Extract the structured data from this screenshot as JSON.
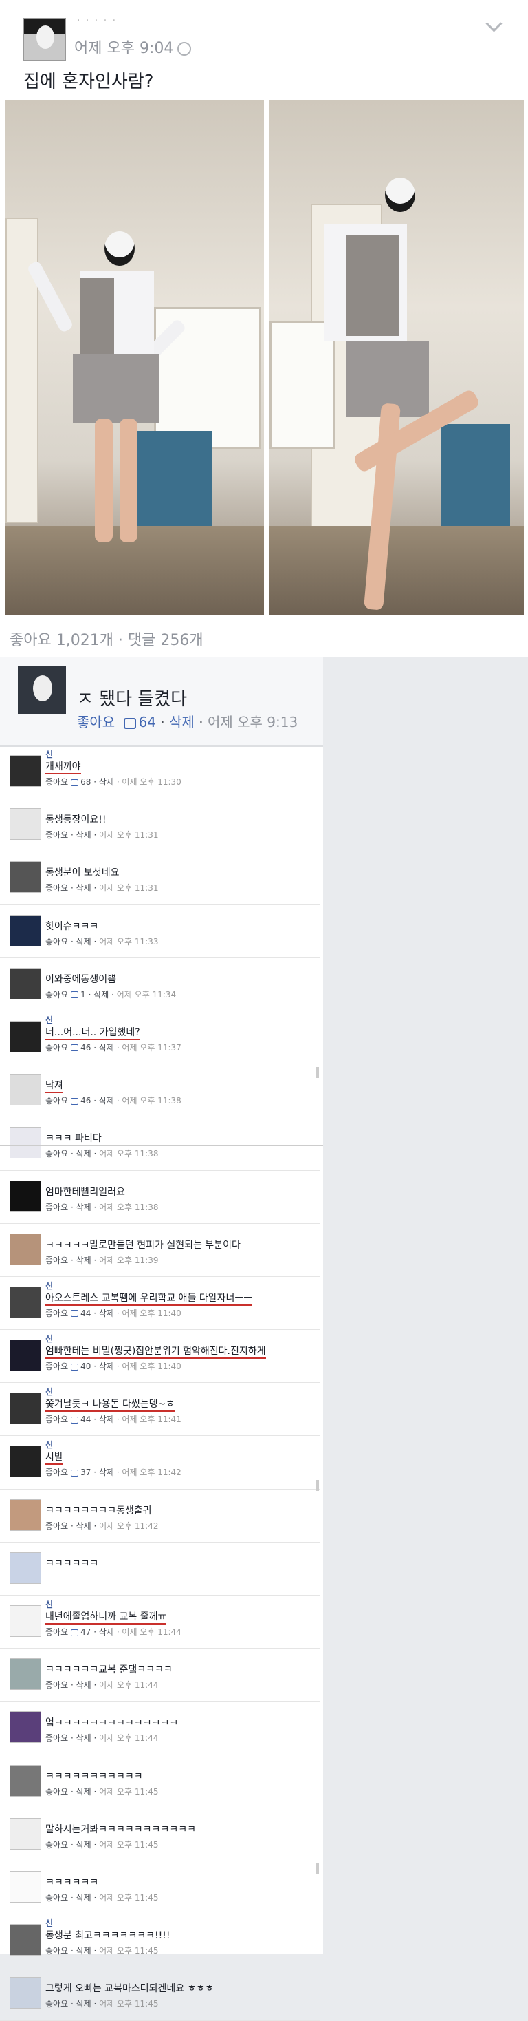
{
  "post": {
    "name": "· · · · ·",
    "time": "어제 오후 9:04",
    "text": "집에 혼자인사람?",
    "stats": "좋아요 1,021개 · 댓글 256개"
  },
  "top_comment": {
    "text": "ㅈ 됐다 들켰다",
    "like_label": "좋아요",
    "like_count": "64",
    "delete_label": "삭제",
    "time": "어제 오후 9:13"
  },
  "comments": [
    {
      "name": "신",
      "text": "개새끼야",
      "like": "좋아요",
      "count": "68",
      "del": "삭제",
      "time": "어제 오후 11:30",
      "red": true
    },
    {
      "name": "",
      "text": "동생등장이요!!",
      "like": "좋아요",
      "count": "",
      "del": "삭제",
      "time": "어제 오후 11:31",
      "red": false
    },
    {
      "name": "",
      "text": "동생분이 보셧네요",
      "like": "좋아요",
      "count": "",
      "del": "삭제",
      "time": "어제 오후 11:31",
      "red": false
    },
    {
      "name": "",
      "text": "핫이슈ㅋㅋㅋ",
      "like": "좋아요",
      "count": "",
      "del": "삭제",
      "time": "어제 오후 11:33",
      "red": false
    },
    {
      "name": "",
      "text": "이와중에동생이쁨",
      "like": "좋아요",
      "count": "1",
      "del": "삭제",
      "time": "어제 오후 11:34",
      "red": false
    },
    {
      "name": "신",
      "text": "너...어...너.. 가입했네?",
      "like": "좋아요",
      "count": "46",
      "del": "삭제",
      "time": "어제 오후 11:37",
      "red": true
    },
    {
      "name": "",
      "text": "닥져",
      "like": "좋아요",
      "count": "46",
      "del": "삭제",
      "time": "어제 오후 11:38",
      "red": true
    },
    {
      "name": "",
      "text": "ㅋㅋㅋ 파티다",
      "like": "좋아요",
      "count": "",
      "del": "삭제",
      "time": "어제 오후 11:38",
      "red": false
    },
    {
      "name": "",
      "text": "엄마한테빨리일러요",
      "like": "좋아요",
      "count": "",
      "del": "삭제",
      "time": "어제 오후 11:38",
      "red": false
    },
    {
      "name": "",
      "text": "ㅋㅋㅋㅋㅋ말로만듣던 현피가 실현되는 부분이다",
      "like": "좋아요",
      "count": "",
      "del": "삭제",
      "time": "어제 오후 11:39",
      "red": false
    },
    {
      "name": "신",
      "text": "아오스트레스 교복뗌에 우리학교 애들 다알자너ㅡㅡ",
      "like": "좋아요",
      "count": "44",
      "del": "삭제",
      "time": "어제 오후 11:40",
      "red": true
    },
    {
      "name": "신",
      "text": "엄빠한테는 비밀(찡긋)집안분위기 험악해진다.진지하게",
      "like": "좋아요",
      "count": "40",
      "del": "삭제",
      "time": "어제 오후 11:40",
      "red": true
    },
    {
      "name": "신",
      "text": "쫓겨날듯ㅋ 나용돈 다썼는뎅~ㅎ",
      "like": "좋아요",
      "count": "44",
      "del": "삭제",
      "time": "어제 오후 11:41",
      "red": true
    },
    {
      "name": "신",
      "text": "시발",
      "like": "좋아요",
      "count": "37",
      "del": "삭제",
      "time": "어제 오후 11:42",
      "red": true
    },
    {
      "name": "",
      "text": "ㅋㅋㅋㅋㅋㅋㅋㅋ동생출귀",
      "like": "좋아요",
      "count": "",
      "del": "삭제",
      "time": "어제 오후 11:42",
      "red": false
    },
    {
      "name": "",
      "text": "ㅋㅋㅋㅋㅋㅋ",
      "like": "",
      "count": "",
      "del": "",
      "time": "",
      "red": false
    },
    {
      "name": "신",
      "text": "내년에졸업하니까 교복 줄께ㅠ",
      "like": "좋아요",
      "count": "47",
      "del": "삭제",
      "time": "어제 오후 11:44",
      "red": true
    },
    {
      "name": "",
      "text": "ㅋㅋㅋㅋㅋㅋ교복 준댘ㅋㅋㅋㅋ",
      "like": "좋아요",
      "count": "",
      "del": "삭제",
      "time": "어제 오후 11:44",
      "red": false
    },
    {
      "name": "",
      "text": "엌ㅋㅋㅋㅋㅋㅋㅋㅋㅋㅋㅋㅋㅋㅋ",
      "like": "좋아요",
      "count": "",
      "del": "삭제",
      "time": "어제 오후 11:44",
      "red": false
    },
    {
      "name": "",
      "text": "ㅋㅋㅋㅋㅋㅋㅋㅋㅋㅋㅋ",
      "like": "좋아요",
      "count": "",
      "del": "삭제",
      "time": "어제 오후 11:45",
      "red": false
    },
    {
      "name": "",
      "text": "말하시는거봐ㅋㅋㅋㅋㅋㅋㅋㅋㅋㅋㅋ",
      "like": "좋아요",
      "count": "",
      "del": "삭제",
      "time": "어제 오후 11:45",
      "red": false
    },
    {
      "name": "",
      "text": "ㅋㅋㅋㅋㅋㅋ",
      "like": "좋아요",
      "count": "",
      "del": "삭제",
      "time": "어제 오후 11:45",
      "red": false
    },
    {
      "name": "신",
      "text": "동생분 최고ㅋㅋㅋㅋㅋㅋㅋ!!!!",
      "like": "좋아요",
      "count": "",
      "del": "삭제",
      "time": "어제 오후 11:45",
      "red": false
    },
    {
      "name": "",
      "text": "그렇게 오빠는 교복마스터되겐네요 ㅎㅎㅎ",
      "like": "좋아요",
      "count": "",
      "del": "삭제",
      "time": "어제 오후 11:45",
      "red": false
    }
  ]
}
